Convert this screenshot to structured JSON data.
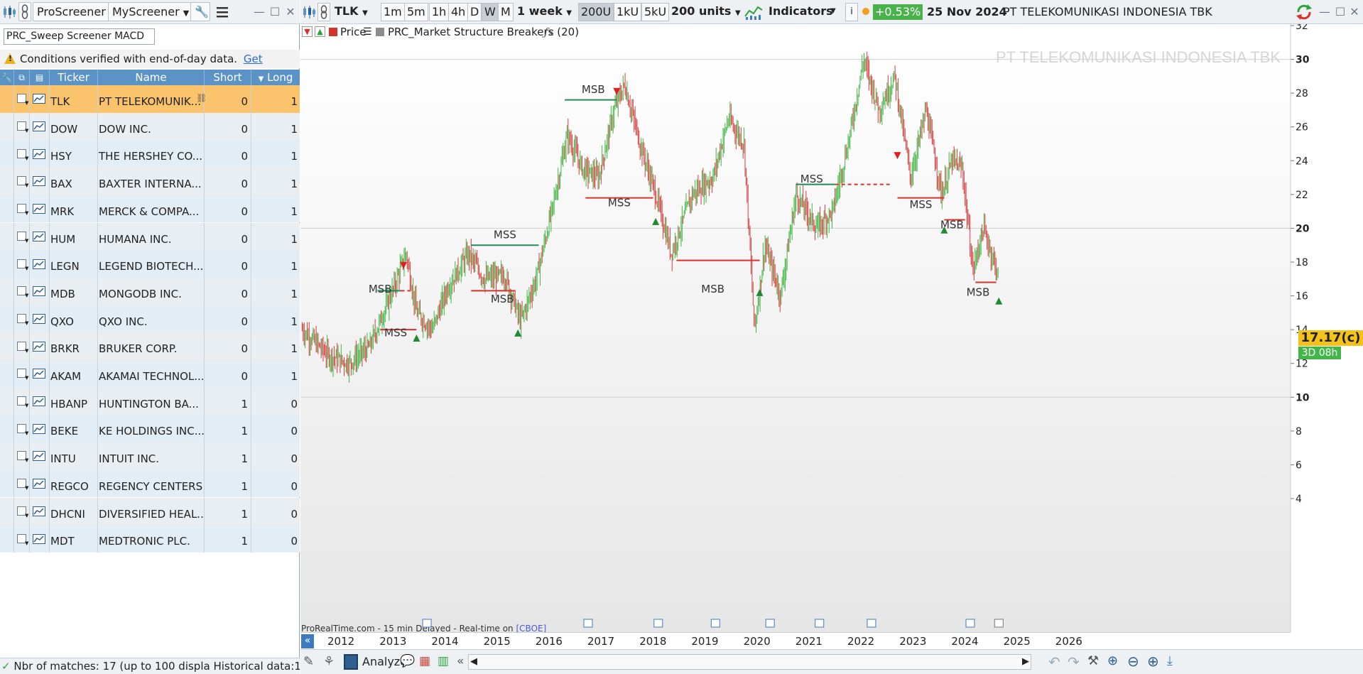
{
  "left_toolbar": {
    "app_title": "ProScreener",
    "my_screener": "MyScreener"
  },
  "screener": {
    "name": "PRC_Sweep Screener MACD",
    "warning": "Conditions verified with end-of-day data.",
    "warning_link": "Get"
  },
  "table": {
    "headers": {
      "ticker": "Ticker",
      "name": "Name",
      "short": "Short",
      "long": "Long"
    },
    "rows": [
      {
        "ticker": "TLK",
        "name": "PT TELEKOMUNIK...",
        "short": "0",
        "long": "1"
      },
      {
        "ticker": "DOW",
        "name": "DOW INC.",
        "short": "0",
        "long": "1"
      },
      {
        "ticker": "HSY",
        "name": "THE HERSHEY CO...",
        "short": "0",
        "long": "1"
      },
      {
        "ticker": "BAX",
        "name": "BAXTER INTERNA...",
        "short": "0",
        "long": "1"
      },
      {
        "ticker": "MRK",
        "name": "MERCK & COMPA...",
        "short": "0",
        "long": "1"
      },
      {
        "ticker": "HUM",
        "name": "HUMANA INC.",
        "short": "0",
        "long": "1"
      },
      {
        "ticker": "LEGN",
        "name": "LEGEND BIOTECH...",
        "short": "0",
        "long": "1"
      },
      {
        "ticker": "MDB",
        "name": "MONGODB INC.",
        "short": "0",
        "long": "1"
      },
      {
        "ticker": "QXO",
        "name": "QXO INC.",
        "short": "0",
        "long": "1"
      },
      {
        "ticker": "BRKR",
        "name": "BRUKER CORP.",
        "short": "0",
        "long": "1"
      },
      {
        "ticker": "AKAM",
        "name": "AKAMAI TECHNOL...",
        "short": "0",
        "long": "1"
      },
      {
        "ticker": "HBANP",
        "name": "HUNTINGTON BA...",
        "short": "1",
        "long": "0"
      },
      {
        "ticker": "BEKE",
        "name": "KE HOLDINGS INC...",
        "short": "1",
        "long": "0"
      },
      {
        "ticker": "INTU",
        "name": "INTUIT INC.",
        "short": "1",
        "long": "0"
      },
      {
        "ticker": "REGCO",
        "name": "REGENCY CENTERS",
        "short": "1",
        "long": "0"
      },
      {
        "ticker": "DHCNI",
        "name": "DIVERSIFIED HEAL...",
        "short": "1",
        "long": "0"
      },
      {
        "ticker": "MDT",
        "name": "MEDTRONIC PLC.",
        "short": "1",
        "long": "0"
      }
    ]
  },
  "status_left": "Nbr of matches: 17 (up to 100 displa Historical data:1",
  "chart_toolbar": {
    "symbol": "TLK",
    "tf_buttons": [
      "1m",
      "5m",
      "1h",
      "4h",
      "D",
      "W",
      "M"
    ],
    "period": "1 week",
    "units_buttons": [
      "200U",
      "1kU",
      "5kU"
    ],
    "units": "200 units",
    "indicators": "Indicators",
    "change": "+0.53%",
    "date": "25 Nov 2024",
    "instrument": "PT TELEKOMUNIKASI INDONESIA TBK"
  },
  "indicator_bar": {
    "price": "Price",
    "indicator": "PRC_Market Structure Breakers (20)"
  },
  "watermark": "PT TELEKOMUNIKASI INDONESIA TBK",
  "source_note": "ProRealTime.com - 15 min Delayed - Real-time on",
  "source_exchange": "[CBOE]",
  "price_axis": [
    "32",
    "30",
    "28",
    "26",
    "24",
    "22",
    "20",
    "18",
    "16",
    "14",
    "12",
    "10",
    "8",
    "6",
    "4"
  ],
  "year_axis": [
    "2012",
    "2013",
    "2014",
    "2015",
    "2016",
    "2017",
    "2018",
    "2019",
    "2020",
    "2021",
    "2022",
    "2023",
    "2024",
    "2025",
    "2026"
  ],
  "last_price": "17.17(c)",
  "bar_time": "3D 08h",
  "bottom_bar": {
    "analyze": "Analyze"
  },
  "chart_data": {
    "type": "line",
    "ylim": [
      3,
      32.5
    ],
    "x": [
      2011.5,
      2012,
      2012.4,
      2012.8,
      2013.2,
      2013.5,
      2013.7,
      2014,
      2014.3,
      2014.7,
      2015,
      2015.4,
      2015.7,
      2016,
      2016.3,
      2016.6,
      2016.9,
      2017.2,
      2017.5,
      2017.7,
      2018,
      2018.3,
      2018.6,
      2019,
      2019.4,
      2019.7,
      2020,
      2020.2,
      2020.4,
      2020.7,
      2021,
      2021.4,
      2021.7,
      2022,
      2022.3,
      2022.6,
      2022.9,
      2023.2,
      2023.5,
      2023.8,
      2024,
      2024.2,
      2024.4,
      2024.6,
      2024.9
    ],
    "series": [
      {
        "values": [
          14,
          12.5,
          12,
          13,
          16,
          18.5,
          15,
          14,
          16.5,
          18.5,
          17,
          17.2,
          14.5,
          17,
          21,
          25.5,
          23.5,
          23,
          27,
          28.5,
          25,
          22,
          18.5,
          22,
          23,
          26.5,
          25,
          14,
          19,
          16,
          22,
          20,
          21,
          25,
          30,
          27,
          29,
          23,
          27,
          22,
          24,
          23.5,
          17.5,
          20,
          17.17
        ]
      }
    ],
    "annotations": [
      {
        "label": "MSB",
        "x": 2013.0,
        "y": 16.2
      },
      {
        "label": "MSS",
        "x": 2013.3,
        "y": 13.6
      },
      {
        "label": "MSS",
        "x": 2015.4,
        "y": 19.4
      },
      {
        "label": "MSB",
        "x": 2015.35,
        "y": 15.6
      },
      {
        "label": "MSB",
        "x": 2017.1,
        "y": 28.0
      },
      {
        "label": "MSS",
        "x": 2017.6,
        "y": 21.3
      },
      {
        "label": "MSB",
        "x": 2019.4,
        "y": 16.2
      },
      {
        "label": "MSS",
        "x": 2021.3,
        "y": 22.7
      },
      {
        "label": "MSS",
        "x": 2023.4,
        "y": 21.2
      },
      {
        "label": "MSB",
        "x": 2024.0,
        "y": 20.0
      },
      {
        "label": "MSB",
        "x": 2024.5,
        "y": 16.0
      }
    ]
  }
}
